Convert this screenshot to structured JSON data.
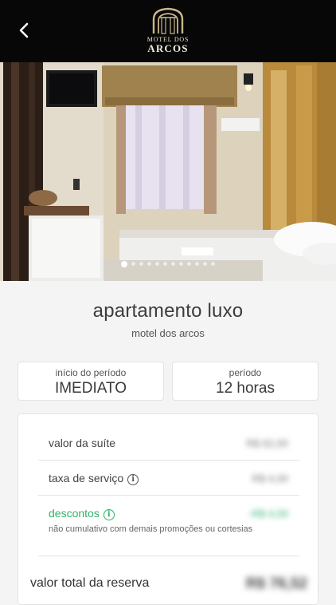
{
  "header": {
    "back_icon": "chevron-left-icon",
    "logo": {
      "line1": "MOTEL DOS",
      "line2": "ARCOS"
    }
  },
  "hero": {
    "dot_count": 12,
    "active_dot": 0
  },
  "room": {
    "title": "apartamento luxo",
    "subtitle": "motel dos arcos"
  },
  "info": {
    "start_label": "início do período",
    "start_value": "IMEDIATO",
    "period_label": "período",
    "period_value": "12 horas"
  },
  "pricing": {
    "suite_label": "valor da suíte",
    "suite_value": "R$ 62,00",
    "fee_label": "taxa de serviço",
    "fee_value": "R$ 4,00",
    "discount_label": "descontos",
    "discount_value": "-R$ 4,00",
    "discount_note": "não cumulativo com demais promoções ou cortesias",
    "total_label": "valor total da reserva",
    "total_value": "R$ 76,52"
  },
  "colors": {
    "accent_green": "#2fb36a",
    "header_bg": "#070707",
    "logo_gold": "#c9b68a"
  }
}
